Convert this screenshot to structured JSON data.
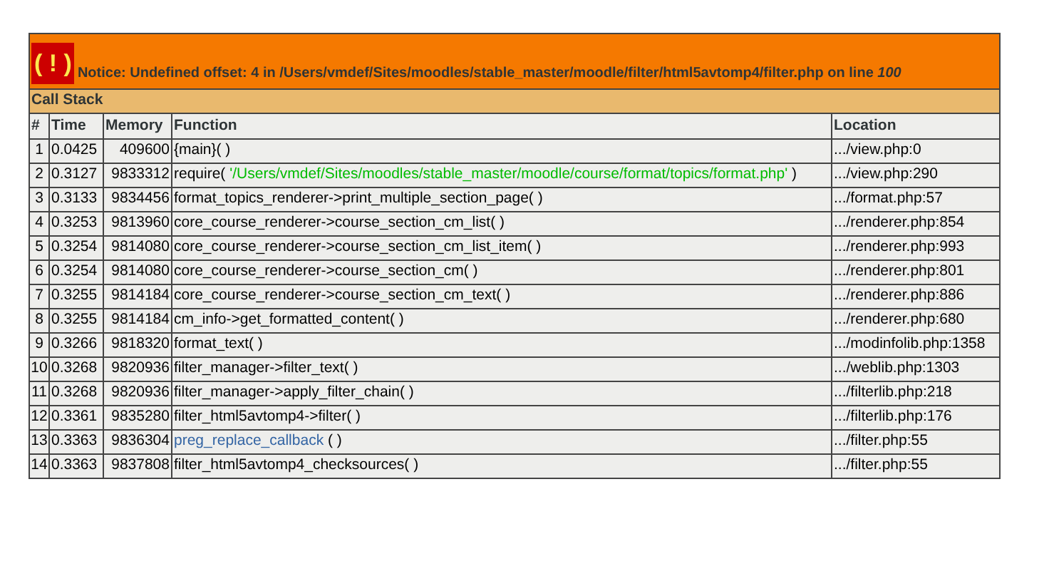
{
  "notice": {
    "icon": "( ! )",
    "message": "Notice: Undefined offset: 4 in /Users/vmdef/Sites/moodles/stable_master/moodle/filter/html5avtomp4/filter.php on line *100*"
  },
  "call_stack": {
    "title": "Call Stack",
    "columns": [
      "#",
      "Time",
      "Memory",
      "Function",
      "Location"
    ],
    "rows": [
      {
        "index": "1",
        "time": "0.0425",
        "memory": "409600",
        "function": [
          {
            "kind": "plain",
            "text": "{main}( )"
          }
        ],
        "location": ".../view.php:0"
      },
      {
        "index": "2",
        "time": "0.3127",
        "memory": "9833312",
        "function": [
          {
            "kind": "plain",
            "text": "require( "
          },
          {
            "kind": "string",
            "text": "'/Users/vmdef/Sites/moodles/stable_master/moodle/course/format/topics/format.php'"
          },
          {
            "kind": "plain",
            "text": " )"
          }
        ],
        "location": ".../view.php:290"
      },
      {
        "index": "3",
        "time": "0.3133",
        "memory": "9834456",
        "function": [
          {
            "kind": "plain",
            "text": "format_topics_renderer->print_multiple_section_page( )"
          }
        ],
        "location": ".../format.php:57"
      },
      {
        "index": "4",
        "time": "0.3253",
        "memory": "9813960",
        "function": [
          {
            "kind": "plain",
            "text": "core_course_renderer->course_section_cm_list( )"
          }
        ],
        "location": ".../renderer.php:854"
      },
      {
        "index": "5",
        "time": "0.3254",
        "memory": "9814080",
        "function": [
          {
            "kind": "plain",
            "text": "core_course_renderer->course_section_cm_list_item( )"
          }
        ],
        "location": ".../renderer.php:993"
      },
      {
        "index": "6",
        "time": "0.3254",
        "memory": "9814080",
        "function": [
          {
            "kind": "plain",
            "text": "core_course_renderer->course_section_cm( )"
          }
        ],
        "location": ".../renderer.php:801"
      },
      {
        "index": "7",
        "time": "0.3255",
        "memory": "9814184",
        "function": [
          {
            "kind": "plain",
            "text": "core_course_renderer->course_section_cm_text( )"
          }
        ],
        "location": ".../renderer.php:886"
      },
      {
        "index": "8",
        "time": "0.3255",
        "memory": "9814184",
        "function": [
          {
            "kind": "plain",
            "text": "cm_info->get_formatted_content( )"
          }
        ],
        "location": ".../renderer.php:680"
      },
      {
        "index": "9",
        "time": "0.3266",
        "memory": "9818320",
        "function": [
          {
            "kind": "plain",
            "text": "format_text( )"
          }
        ],
        "location": ".../modinfolib.php:1358"
      },
      {
        "index": "10",
        "time": "0.3268",
        "memory": "9820936",
        "function": [
          {
            "kind": "plain",
            "text": "filter_manager->filter_text( )"
          }
        ],
        "location": ".../weblib.php:1303"
      },
      {
        "index": "11",
        "time": "0.3268",
        "memory": "9820936",
        "function": [
          {
            "kind": "plain",
            "text": "filter_manager->apply_filter_chain( )"
          }
        ],
        "location": ".../filterlib.php:218"
      },
      {
        "index": "12",
        "time": "0.3361",
        "memory": "9835280",
        "function": [
          {
            "kind": "plain",
            "text": "filter_html5avtomp4->filter( )"
          }
        ],
        "location": ".../filterlib.php:176"
      },
      {
        "index": "13",
        "time": "0.3363",
        "memory": "9836304",
        "function": [
          {
            "kind": "link",
            "text": "preg_replace_callback"
          },
          {
            "kind": "plain",
            "text": " ( )"
          }
        ],
        "location": ".../filter.php:55"
      },
      {
        "index": "14",
        "time": "0.3363",
        "memory": "9837808",
        "function": [
          {
            "kind": "plain",
            "text": "filter_html5avtomp4_checksources( )"
          }
        ],
        "location": ".../filter.php:55"
      }
    ]
  }
}
